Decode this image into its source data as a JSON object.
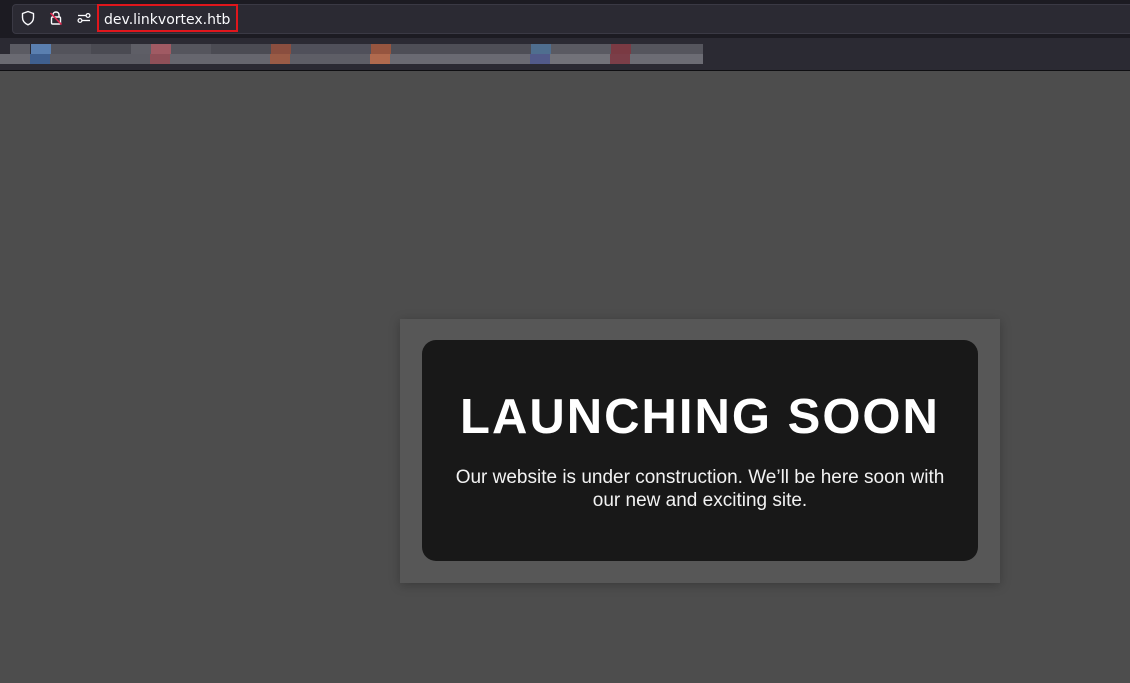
{
  "browser": {
    "url": "dev.linkvortex.htb",
    "icons": {
      "tracking_protection": "shield-icon",
      "connection": "insecure-lock-icon",
      "permissions": "permissions-icon"
    },
    "bookmarks_bar": "pixelated-bookmarks"
  },
  "page": {
    "headline": "LAUNCHING SOON",
    "message": "Our website is under construction. We’ll be here soon with our new and exciting site."
  },
  "colors": {
    "page_background": "#4d4d4d",
    "card_background": "#181818",
    "highlight": "#e0161c"
  }
}
